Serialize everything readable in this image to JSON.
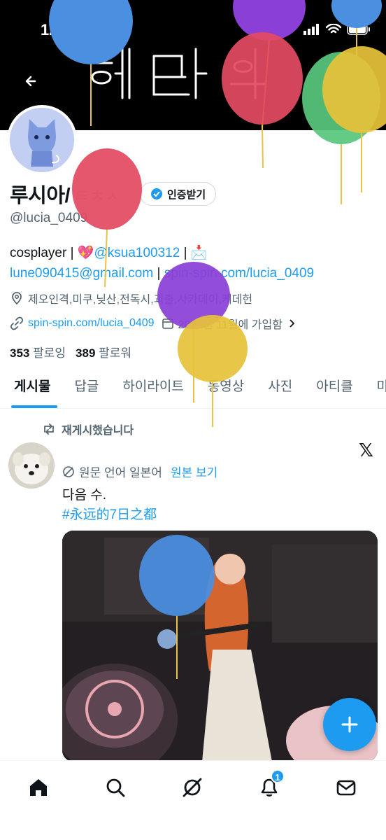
{
  "status_bar": {
    "time": "12:58"
  },
  "banner": {
    "scribble": "헤더 이미지"
  },
  "profile": {
    "display_name": "루시아/",
    "name_suffix": "ㅌㅊㅅ",
    "handle": "@lucia_0409",
    "verify_button": "인증받기",
    "bio_prefix": "cosplayer | 💖",
    "bio_mention": "@ksua100312",
    "bio_mid": " | 📩",
    "bio_email": "lune090415@gmail.com",
    "bio_sep": " | ",
    "bio_link": "spin-spin.com/lucia_0409",
    "location": "제오인격,미쿠,닞산,전독시,괴출,사카데이,케데헌",
    "website": "spin-spin.com/lucia_0409",
    "joined": "2023년 11월에 가입함",
    "following_count": "353",
    "following_label": "팔로잉",
    "followers_count": "389",
    "followers_label": "팔로워"
  },
  "tabs": [
    "게시물",
    "답글",
    "하이라이트",
    "동영상",
    "사진",
    "아티클",
    "마"
  ],
  "post": {
    "repost_label": "재게시했습니다",
    "translate_label": "원문 언어 일본어",
    "show_original": "원본 보기",
    "text": "다음 수.",
    "hashtag": "#永远的7日之都"
  },
  "nav": {
    "notification_count": "1"
  },
  "colors": {
    "accent": "#1d9bf0",
    "text": "#0f1419",
    "muted": "#536471"
  },
  "icons": [
    "back-arrow-icon",
    "location-pin-icon",
    "link-icon",
    "repost-icon",
    "x-logo-icon",
    "translate-icon",
    "plus-icon",
    "home-icon",
    "search-icon",
    "grok-icon",
    "bell-icon",
    "mail-icon"
  ]
}
